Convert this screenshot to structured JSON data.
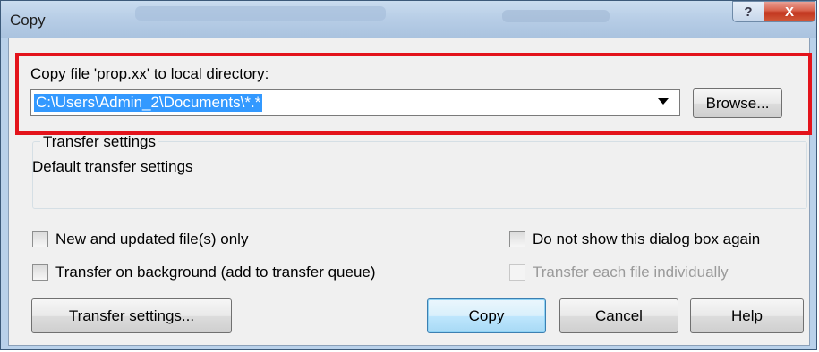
{
  "window": {
    "title": "Copy",
    "help_glyph": "?",
    "close_glyph": "X"
  },
  "target": {
    "label": "Copy file 'prop.xx' to local directory:",
    "path_value": "C:\\Users\\Admin_2\\Documents\\*.*",
    "browse_label": "Browse..."
  },
  "transfer_group": {
    "legend": "Transfer settings",
    "value": "Default transfer settings"
  },
  "options": {
    "new_updated_only": {
      "label": "New and updated file(s) only",
      "checked": false
    },
    "do_not_show_again": {
      "label": "Do not show this dialog box again",
      "checked": false
    },
    "transfer_background": {
      "label": "Transfer on background (add to transfer queue)",
      "checked": false
    },
    "transfer_individually": {
      "label": "Transfer each file individually",
      "checked": false,
      "enabled": false
    }
  },
  "buttons": {
    "transfer_settings": "Transfer settings...",
    "copy": "Copy",
    "cancel": "Cancel",
    "help": "Help"
  },
  "colors": {
    "highlight_border": "#e3131b",
    "selection": "#3399ff",
    "close_button": "#c2361f"
  }
}
